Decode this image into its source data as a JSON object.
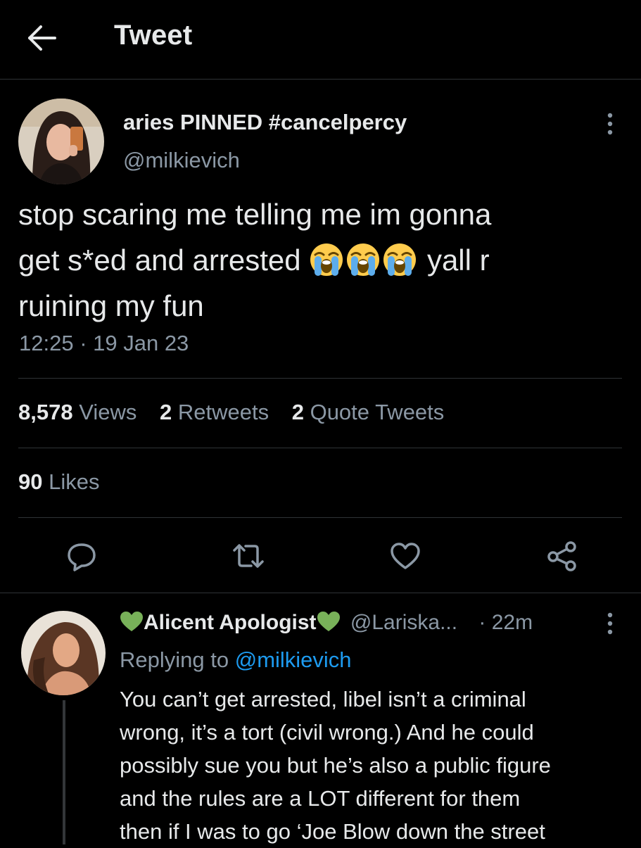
{
  "header": {
    "title": "Tweet"
  },
  "tweet": {
    "author_name": "aries PINNED #cancelpercy",
    "author_handle": "@milkievich",
    "text_line1": "stop scaring me telling me im gonna",
    "text_line2_start": "get s*ed and arrested",
    "text_line2_end": "yall r",
    "text_line3": "ruining my fun",
    "emoji": "loudly-crying-face",
    "timestamp": "12:25 · 19 Jan 23",
    "views_count": "8,578",
    "views_label": "Views",
    "retweets_count": "2",
    "retweets_label": "Retweets",
    "quotes_count": "2",
    "quotes_label": "Quote Tweets",
    "likes_count": "90",
    "likes_label": "Likes"
  },
  "actions": [
    "reply-icon",
    "retweet-icon",
    "like-icon",
    "share-icon"
  ],
  "reply": {
    "author_name": "Alicent Apologist",
    "author_handle": "@Lariska...",
    "time": "· 22m",
    "replying_prefix": "Replying to",
    "replying_mention": "@milkievich",
    "lines": [
      "You can’t get arrested, libel isn’t a criminal",
      "wrong, it’s a tort (civil wrong.) And he could",
      "possibly sue you but he’s also a public figure",
      "and the rules are a LOT different for them",
      "then if I was to go ‘Joe Blow down the street"
    ]
  },
  "colors": {
    "background": "#000000",
    "text_primary": "#e7e9ea",
    "text_secondary": "#8b98a5",
    "accent": "#1d9bf0",
    "divider": "#2f3336",
    "green_heart": "#78b159"
  }
}
